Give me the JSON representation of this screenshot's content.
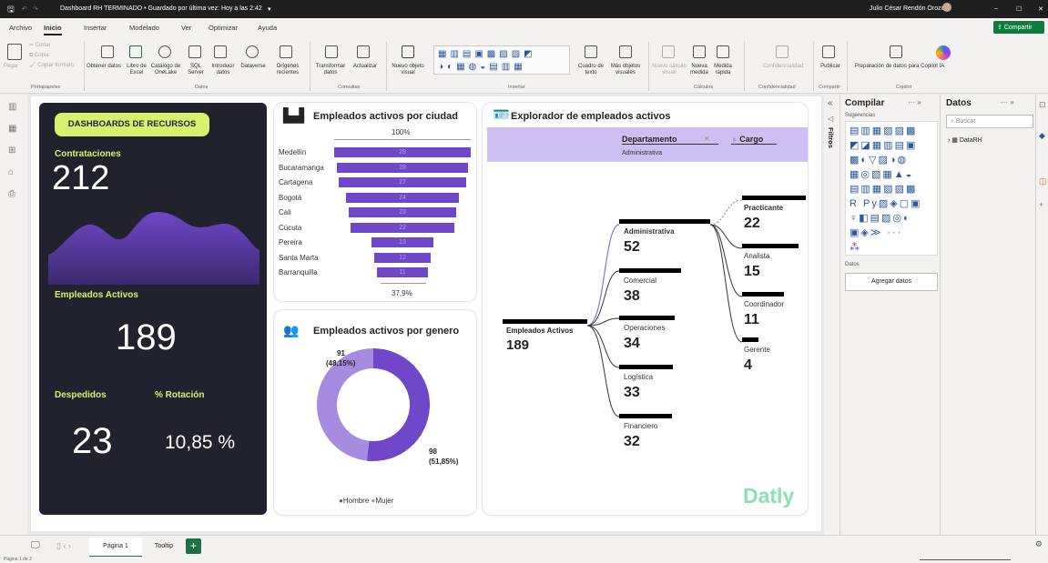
{
  "titlebar": {
    "doc_title": "Dashboard RH TERMINADO • Guardado por última vez: Hoy a las 2:42",
    "user": "Julio César Rendón Orozco"
  },
  "menu": [
    "Archivo",
    "Inicio",
    "Insertar",
    "Modelado",
    "Ver",
    "Optimizar",
    "Ayuda"
  ],
  "share_label": "Compartir",
  "ribbon": {
    "pegar": "Pegar",
    "cortar": "Cortar",
    "copia": "Copia",
    "copiar_formato": "Copiar formato",
    "portapapeles": "Portapapeles",
    "obtener": "Obtener datos",
    "libro": "Libro de Excel",
    "catalogo": "Catálogo de OneLake",
    "sql": "SQL Server",
    "introducir": "Introducir datos",
    "dataverse": "Dataverse",
    "origenes": "Orígenes recientes",
    "datos_group": "Datos",
    "transformar": "Transformar datos",
    "actualizar": "Actualizar",
    "consultas": "Consultas",
    "nuevo_objeto": "Nuevo objeto visual",
    "cuadro": "Cuadro de texto",
    "mas_objetos": "Más objetos visuales",
    "insertar": "Insertar",
    "nuevo_calculo": "Nuevo cálculo visual",
    "nueva_medida": "Nueva medida",
    "medida_rapida": "Medida rápida",
    "calculos": "Cálculos",
    "confidencialidad": "Confidencialidad",
    "conf_group": "Confidencialidad",
    "publicar": "Publicar",
    "compartir": "Compartir",
    "preparacion": "Preparación de datos para Copilot IA",
    "copilot": "Copilot"
  },
  "hr": {
    "title": "DASHBOARDS DE RECURSOS HUMANOS",
    "contrataciones_label": "Contrataciones",
    "contrataciones_value": "212",
    "activos_label": "Empleados Activos",
    "activos_value": "189",
    "despedidos_label": "Despedidos",
    "despedidos_value": "23",
    "rotacion_label": "% Rotación",
    "rotacion_value": "10,85 %"
  },
  "funnel": {
    "title": "Empleados activos por ciudad",
    "top_pct": "100%",
    "bottom_pct": "37,9%",
    "bar_color": "#6f47c8",
    "cities": [
      {
        "name": "Medellín",
        "value": 29
      },
      {
        "name": "Bucaramanga",
        "value": 28
      },
      {
        "name": "Cartagena",
        "value": 27
      },
      {
        "name": "Bogotá",
        "value": 24
      },
      {
        "name": "Cali",
        "value": 23
      },
      {
        "name": "Cúcuta",
        "value": 22
      },
      {
        "name": "Pereira",
        "value": 13
      },
      {
        "name": "Santa Marta",
        "value": 12
      },
      {
        "name": "Barranquilla",
        "value": 11
      }
    ]
  },
  "donut": {
    "title": "Empleados activos por genero",
    "hombre_value": "98",
    "hombre_pct": "(51,85%)",
    "mujer_value": "91",
    "mujer_pct": "(48,15%)",
    "legend_hombre": "Hombre",
    "legend_mujer": "Mujer",
    "colors": {
      "hombre": "#6f47c8",
      "mujer": "#a78be0"
    }
  },
  "explorer": {
    "title": "Explorador de empleados activos",
    "filter_departamento": "Departamento",
    "filter_value": "Administrativa",
    "filter_cargo": "Cargo",
    "root_label": "Empleados Activos",
    "root_value": "189",
    "departments": [
      {
        "name": "Administrativa",
        "value": "52"
      },
      {
        "name": "Comercial",
        "value": "38"
      },
      {
        "name": "Operaciones",
        "value": "34"
      },
      {
        "name": "Logística",
        "value": "33"
      },
      {
        "name": "Financiero",
        "value": "32"
      }
    ],
    "roles": [
      {
        "name": "Practicante",
        "value": "22"
      },
      {
        "name": "Analista",
        "value": "15"
      },
      {
        "name": "Coordinador",
        "value": "11"
      },
      {
        "name": "Gerente",
        "value": "4"
      }
    ],
    "brand": "Datly"
  },
  "pane": {
    "compilar": "Compilar",
    "sugerencias": "Sugerencias",
    "datos_section": "Datos",
    "agregar": "Agregar datos",
    "datos_title": "Datos",
    "buscar": "Buscar",
    "table": "DataRH",
    "filtros": "Filtros"
  },
  "pages": {
    "page1": "Página 1",
    "tooltip": "Tooltip"
  },
  "status": "Página 1 de 2"
}
